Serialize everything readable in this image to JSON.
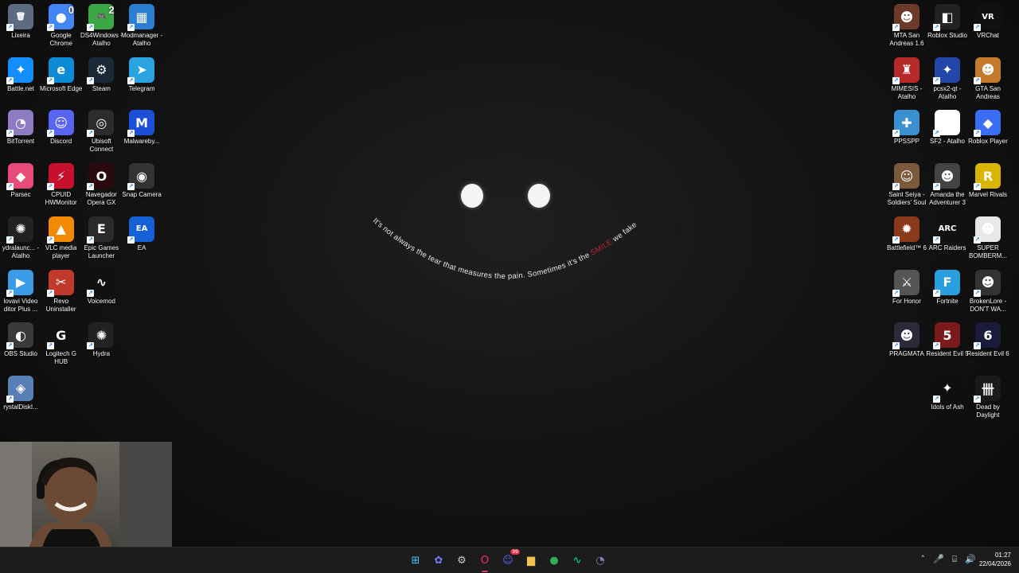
{
  "wallpaper": {
    "quote_start": "It's not always the tear that measures the pain. Sometimes it's the ",
    "quote_highlight": "SMILE",
    "quote_end": " we fake"
  },
  "desktop_icons_left": [
    {
      "label": "Lixeira",
      "color": "#5b6b82",
      "glyph": "🗑",
      "badge": ""
    },
    {
      "label": "Google Chrome",
      "color": "#4285f4",
      "glyph": "●",
      "badge": "0"
    },
    {
      "label": "DS4Windows - Atalho",
      "color": "#3aa845",
      "glyph": "🎮",
      "badge": "2"
    },
    {
      "label": "Modmanager - Atalho",
      "color": "#2a7fd0",
      "glyph": "▦",
      "badge": ""
    },
    {
      "label": "Battle.net",
      "color": "#148eff",
      "glyph": "✦",
      "badge": ""
    },
    {
      "label": "Microsoft Edge",
      "color": "#0c8bd6",
      "glyph": "e",
      "badge": ""
    },
    {
      "label": "Steam",
      "color": "#1b2838",
      "glyph": "⚙",
      "badge": ""
    },
    {
      "label": "Telegram",
      "color": "#2aa3e0",
      "glyph": "➤",
      "badge": ""
    },
    {
      "label": "BitTorrent",
      "color": "#8e7cc3",
      "glyph": "◔",
      "badge": ""
    },
    {
      "label": "Discord",
      "color": "#5865f2",
      "glyph": "☺",
      "badge": ""
    },
    {
      "label": "Ubisoft Connect",
      "color": "#2c2c2c",
      "glyph": "◎",
      "badge": ""
    },
    {
      "label": "Malwareby...",
      "color": "#1b4fd8",
      "glyph": "M",
      "badge": ""
    },
    {
      "label": "Parsec",
      "color": "#e84a7a",
      "glyph": "◆",
      "badge": ""
    },
    {
      "label": "CPUID HWMonitor",
      "color": "#c8102e",
      "glyph": "⚡",
      "badge": ""
    },
    {
      "label": "Navegador Opera GX",
      "color": "#2b0a0f",
      "glyph": "O",
      "badge": ""
    },
    {
      "label": "Snap Camera",
      "color": "#333333",
      "glyph": "◉",
      "badge": ""
    },
    {
      "label": "ydralaunc... - Atalho",
      "color": "#222222",
      "glyph": "✺",
      "badge": ""
    },
    {
      "label": "VLC media player",
      "color": "#f28a00",
      "glyph": "▲",
      "badge": ""
    },
    {
      "label": "Epic Games Launcher",
      "color": "#2a2a2a",
      "glyph": "E",
      "badge": ""
    },
    {
      "label": "EA",
      "color": "#1560d6",
      "glyph": "EA",
      "badge": ""
    },
    {
      "label": "lovavi Video ditor Plus ...",
      "color": "#3a9be8",
      "glyph": "▶",
      "badge": ""
    },
    {
      "label": "Revo Uninstaller",
      "color": "#c0392b",
      "glyph": "✂",
      "badge": ""
    },
    {
      "label": "Voicemod",
      "color": "#111111",
      "glyph": "∿",
      "badge": ""
    },
    {
      "label": "OBS Studio",
      "color": "#3a3a3a",
      "glyph": "◐",
      "badge": ""
    },
    {
      "label": "Logitech G HUB",
      "color": "#111111",
      "glyph": "G",
      "badge": ""
    },
    {
      "label": "Hydra",
      "color": "#222222",
      "glyph": "✺",
      "badge": ""
    },
    {
      "label": "rystalDiskI...",
      "color": "#5a7fb5",
      "glyph": "◈",
      "badge": ""
    }
  ],
  "desktop_icons_right": [
    {
      "label": "MTA San Andreas 1.6",
      "color": "#6b3a2a",
      "glyph": "☻"
    },
    {
      "label": "Roblox Studio",
      "color": "#222222",
      "glyph": "◧"
    },
    {
      "label": "VRChat",
      "color": "#111111",
      "glyph": "VR"
    },
    {
      "label": "MIMESIS - Atalho",
      "color": "#b72a2a",
      "glyph": "♜"
    },
    {
      "label": "pcsx2-qt - Atalho",
      "color": "#2446a8",
      "glyph": "✦"
    },
    {
      "label": "GTA San Andreas",
      "color": "#c47a2a",
      "glyph": "☻"
    },
    {
      "label": "PPSSPP",
      "color": "#3a8fd0",
      "glyph": "✚"
    },
    {
      "label": "SF2 - Atalho",
      "color": "#ffffff",
      "glyph": "✎"
    },
    {
      "label": "Roblox Player",
      "color": "#3b6ef5",
      "glyph": "◆"
    },
    {
      "label": "Saint Seiya - Soldiers' Soul",
      "color": "#7a5a3a",
      "glyph": "☺"
    },
    {
      "label": "Amanda the Adventurer 3",
      "color": "#444444",
      "glyph": "☻"
    },
    {
      "label": "Marvel Rivals",
      "color": "#d8b600",
      "glyph": "R"
    },
    {
      "label": "Battlefield™ 6",
      "color": "#8a3a1a",
      "glyph": "✹"
    },
    {
      "label": "ARC Raiders",
      "color": "#111111",
      "glyph": "ARC"
    },
    {
      "label": "SUPER BOMBERM...",
      "color": "#e8e8e8",
      "glyph": "☻"
    },
    {
      "label": "For Honor",
      "color": "#555555",
      "glyph": "⚔"
    },
    {
      "label": "Fortnite",
      "color": "#2a9fe0",
      "glyph": "F"
    },
    {
      "label": "BrokenLore - DON'T WA...",
      "color": "#333333",
      "glyph": "☻"
    },
    {
      "label": "PRAGMATA",
      "color": "#2a2a3a",
      "glyph": "☻"
    },
    {
      "label": "Resident Evil 5",
      "color": "#7a1a1a",
      "glyph": "5"
    },
    {
      "label": "Resident Evil 6",
      "color": "#1a1a3a",
      "glyph": "6"
    },
    {
      "label": "Idols of Ash",
      "color": "#0e0e0e",
      "glyph": "✦"
    },
    {
      "label": "Dead by Daylight",
      "color": "#1a1a1a",
      "glyph": "卌"
    }
  ],
  "taskbar": {
    "apps": [
      {
        "name": "start-button",
        "glyph": "⊞",
        "color": "#4cc2ff"
      },
      {
        "name": "copilot-icon",
        "glyph": "✿",
        "color": "#7b7bff"
      },
      {
        "name": "settings-icon",
        "glyph": "⚙",
        "color": "#cccccc"
      },
      {
        "name": "opera-gx-icon",
        "glyph": "O",
        "color": "#ff2d55"
      },
      {
        "name": "discord-icon",
        "glyph": "☺",
        "color": "#5865f2"
      },
      {
        "name": "file-explorer-icon",
        "glyph": "▆",
        "color": "#f2c14e"
      },
      {
        "name": "chrome-icon",
        "glyph": "●",
        "color": "#34a853"
      },
      {
        "name": "voicemod-icon",
        "glyph": "∿",
        "color": "#00e0b0"
      },
      {
        "name": "bittorrent-icon",
        "glyph": "◔",
        "color": "#8e7cc3"
      }
    ],
    "discord_badge": "99",
    "time": "01:27",
    "date": "22/04/2026"
  }
}
